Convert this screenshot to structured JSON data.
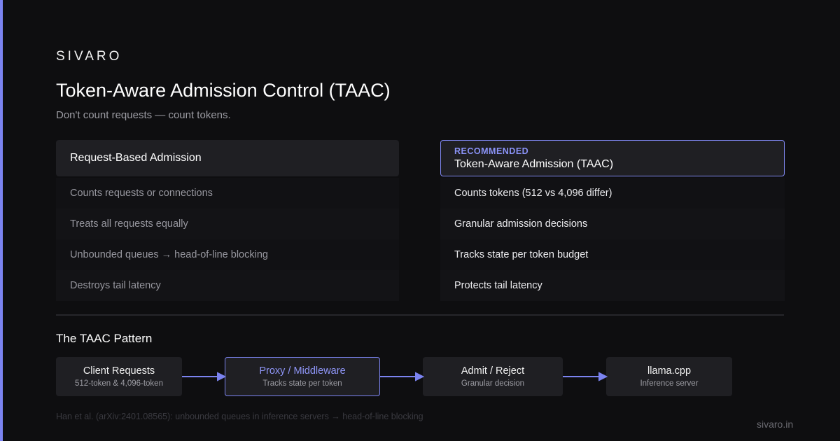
{
  "brand": "SIVARO",
  "title": "Token-Aware Admission Control (TAAC)",
  "subtitle": "Don't count requests — count tokens.",
  "left_card": {
    "heading": "Request-Based Admission",
    "items": [
      "Counts requests or connections",
      "Treats all requests equally",
      "Unbounded queues → head-of-line blocking",
      "Destroys tail latency"
    ]
  },
  "right_card": {
    "tag": "RECOMMENDED",
    "heading": "Token-Aware Admission (TAAC)",
    "items": [
      "Counts tokens (512 vs 4,096 differ)",
      "Granular admission decisions",
      "Tracks state per token budget",
      "Protects tail latency"
    ]
  },
  "pattern": {
    "title": "The TAAC Pattern",
    "steps": [
      {
        "label": "Client Requests",
        "sub": "512-token & 4,096-token"
      },
      {
        "label": "Proxy / Middleware",
        "sub": "Tracks state per token"
      },
      {
        "label": "Admit / Reject",
        "sub": "Granular decision"
      },
      {
        "label": "llama.cpp",
        "sub": "Inference server"
      }
    ]
  },
  "citation": "Han et al. (arXiv:2401.08565): unbounded queues in inference servers → head-of-line blocking",
  "site": "sivaro.in",
  "colors": {
    "background": "#0e0e10",
    "accent": "#7b83f0",
    "card": "#1f1f23"
  }
}
